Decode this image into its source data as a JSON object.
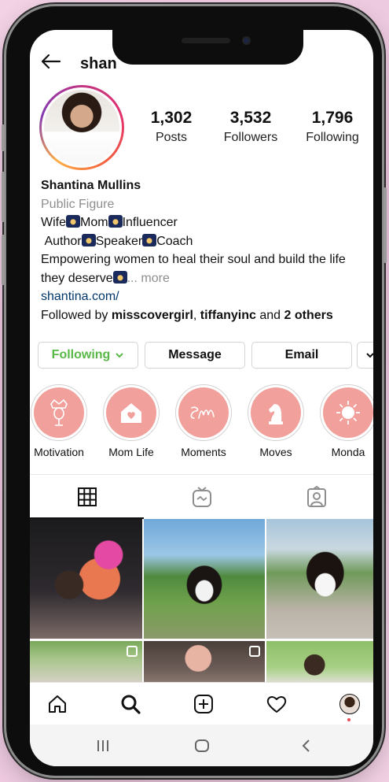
{
  "profile": {
    "username_partial": "shan",
    "name": "Shantina Mullins",
    "category": "Public Figure",
    "bio_line1": [
      "Wife",
      "Mom",
      "Influencer"
    ],
    "bio_line2": [
      "Author",
      "Speaker",
      "Coach"
    ],
    "bio_line3": "Empowering women to heal their soul and build the life",
    "bio_line4": "they deserve",
    "more": "... more",
    "link": "shantina.com/",
    "followed_by_prefix": "Followed by ",
    "followed_by_user1": "misscovergirl",
    "followed_by_sep": ", ",
    "followed_by_user2": "tiffanyinc",
    "followed_by_and": " and ",
    "followed_by_others": "2 others"
  },
  "stats": [
    {
      "value": "1,302",
      "label": "Posts"
    },
    {
      "value": "3,532",
      "label": "Followers"
    },
    {
      "value": "1,796",
      "label": "Following"
    }
  ],
  "buttons": {
    "following": "Following",
    "message": "Message",
    "email": "Email"
  },
  "highlights": [
    {
      "label": "Motivation",
      "icon": "crown-mic-icon"
    },
    {
      "label": "Mom Life",
      "icon": "house-heart-icon"
    },
    {
      "label": "Moments",
      "icon": "sm-monogram-icon"
    },
    {
      "label": "Moves",
      "icon": "chess-knight-icon"
    },
    {
      "label": "Monda",
      "icon": "sun-icon"
    }
  ],
  "colors": {
    "highlight_fill": "#f1a09c",
    "following_green": "#57b846",
    "link_blue": "#00376b",
    "notification_red": "#ed4956"
  }
}
